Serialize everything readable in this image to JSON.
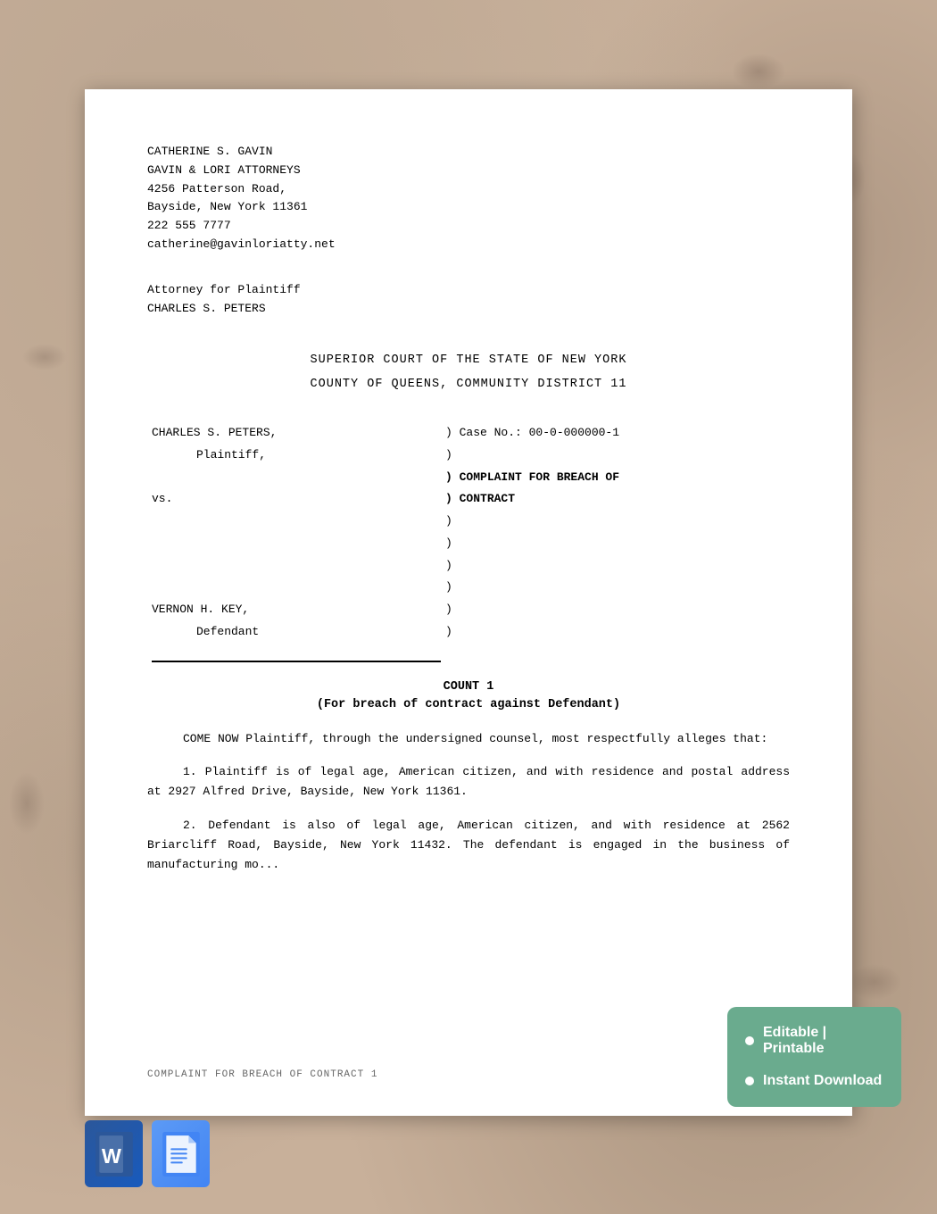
{
  "background": {
    "color": "#c8b09a"
  },
  "document": {
    "attorney": {
      "name": "CATHERINE S. GAVIN",
      "firm": "GAVIN & LORI ATTORNEYS",
      "address_line1": "4256 Patterson Road,",
      "address_line2": "Bayside, New York 11361",
      "phone": "222 555 7777",
      "email": "catherine@gavinloriatty.net"
    },
    "attorney_for_label": "Attorney for Plaintiff",
    "plaintiff_name": "CHARLES S. PETERS",
    "court": {
      "name": "SUPERIOR COURT OF THE STATE OF NEW YORK",
      "district": "COUNTY OF QUEENS, COMMUNITY DISTRICT 11"
    },
    "case": {
      "plaintiff_label": "CHARLES S. PETERS,",
      "plaintiff_role": "Plaintiff,",
      "vs": "vs.",
      "defendant_label": "VERNON H. KEY,",
      "defendant_role": "Defendant",
      "case_no_label": ") Case No.:  00-0-000000-1",
      "paren1": ")",
      "paren2": ") COMPLAINT FOR BREACH OF",
      "paren3": ") CONTRACT",
      "paren4": ")",
      "paren5": ")",
      "paren6": ")",
      "paren7": ")",
      "paren8": ")",
      "paren9": ")"
    },
    "count": {
      "header": "COUNT 1",
      "subheader": "(For breach of contract against Defendant)"
    },
    "paragraphs": {
      "intro": "COME  NOW  Plaintiff,  through  the  undersigned  counsel,  most respectfully alleges that:",
      "para1": "1.  Plaintiff  is  of  legal  age,  American  citizen,  and  with residence  and  postal  address  at  2927  Alfred  Drive,  Bayside,  New York 11361.",
      "para2": "2. Defendant is also of legal age, American citizen, and with residence at 2562 Briarcliff Road, Bayside, New York 11432. The defendant is engaged in the business of manufacturing mo..."
    },
    "footer": "COMPLAINT FOR BREACH OF CONTRACT 1"
  },
  "badge": {
    "item1": "Editable | Printable",
    "item2": "Instant Download",
    "background_color": "#6aab8e"
  },
  "icons": {
    "word": {
      "label": "W",
      "title": "Microsoft Word Document"
    },
    "docs": {
      "label": "Docs",
      "title": "Google Docs Document"
    }
  }
}
